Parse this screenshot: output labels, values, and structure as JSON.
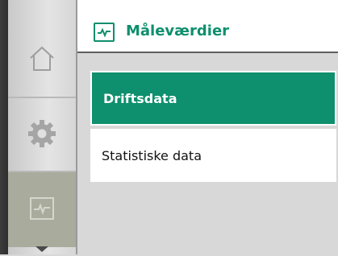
{
  "header": {
    "title": "Måleværdier",
    "icon": "measurement-icon",
    "accent": "#0e8f6e"
  },
  "sidebar": {
    "items": [
      {
        "name": "home",
        "icon": "home-icon",
        "active": false
      },
      {
        "name": "settings",
        "icon": "gear-icon",
        "active": false
      },
      {
        "name": "measurements",
        "icon": "measurement-icon",
        "active": true
      }
    ],
    "scroll_icon": "chevron-down-icon"
  },
  "menu": {
    "items": [
      {
        "label": "Driftsdata",
        "selected": true
      },
      {
        "label": "Statistiske data",
        "selected": false
      }
    ]
  }
}
